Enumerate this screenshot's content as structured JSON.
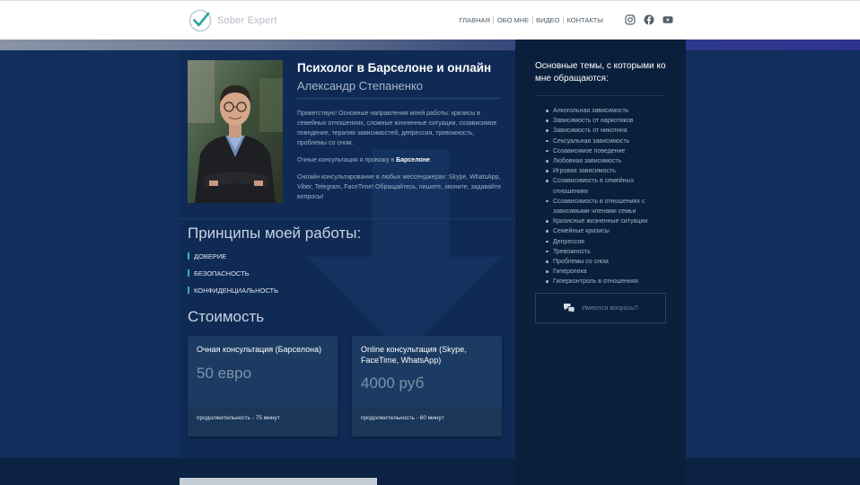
{
  "header": {
    "logo_text": "Sober Expert",
    "nav": [
      "ГЛАВНАЯ",
      "ОБО МНЕ",
      "ВИДЕО",
      "КОНТАКТЫ"
    ],
    "social_icons": [
      "instagram-icon",
      "facebook-icon",
      "youtube-icon"
    ]
  },
  "intro": {
    "title": "Психолог в Барселоне и онлайн",
    "subtitle": "Александр Степаненко",
    "para1": "Приветствую! Основные направления моей работы: кризисы в семейных отношениях, сложные жизненные ситуации, созависимое поведение, терапия зависимостей, депрессия, тревожность, проблемы со сном.",
    "para2_prefix": "Очные консультации я провожу в ",
    "para2_city": "Барселоне",
    "para2_suffix": ".",
    "para3": "Онлайн консультирование в любых мессенджерах: Skype, WhatsApp, Viber, Telegram, FaceTime! Обращайтесь, пишите, звоните, задавайте вопросы!"
  },
  "principles": {
    "heading": "Принципы моей работы:",
    "items": [
      "ДОВЕРИЕ",
      "БЕЗОПАСНОСТЬ",
      "КОНФИДЕНЦИАЛЬНОСТЬ"
    ]
  },
  "pricing": {
    "heading": "Стоимость",
    "cards": [
      {
        "name": "Очная консультация (Барселона)",
        "price": "50 евро",
        "duration": "продолжительность - 75 минут"
      },
      {
        "name": "Online консультация (Skype, FaceTime, WhatsApp)",
        "price": "4000 руб",
        "duration": "продолжительность - 60 минут"
      }
    ]
  },
  "sidebar": {
    "title": "Основные темы, с которыми ко мне обращаются:",
    "topics": [
      "Алкогольная зависимость",
      "Зависимость от наркотиков",
      "Зависимость от никотина",
      "Сексуальная зависимость",
      "Созависимое поведение",
      "Любовная зависимость",
      "Игровая зависимость",
      "Созависимость в семейных отношениях",
      "Созависимость в отношениях с зависимыми членами семьи",
      "Кризисные жизненные ситуации",
      "Семейные кризисы",
      "Депрессия",
      "Тревожность",
      "Проблемы со сном",
      "Гиперопека",
      "Гиперконтроль в отношениях"
    ],
    "ask_button": "Имеются вопросы?"
  },
  "colors": {
    "accent": "#2db8b0",
    "background": "#112e5c",
    "sidebar": "#0a1f3b",
    "card": "#1c3b62"
  }
}
